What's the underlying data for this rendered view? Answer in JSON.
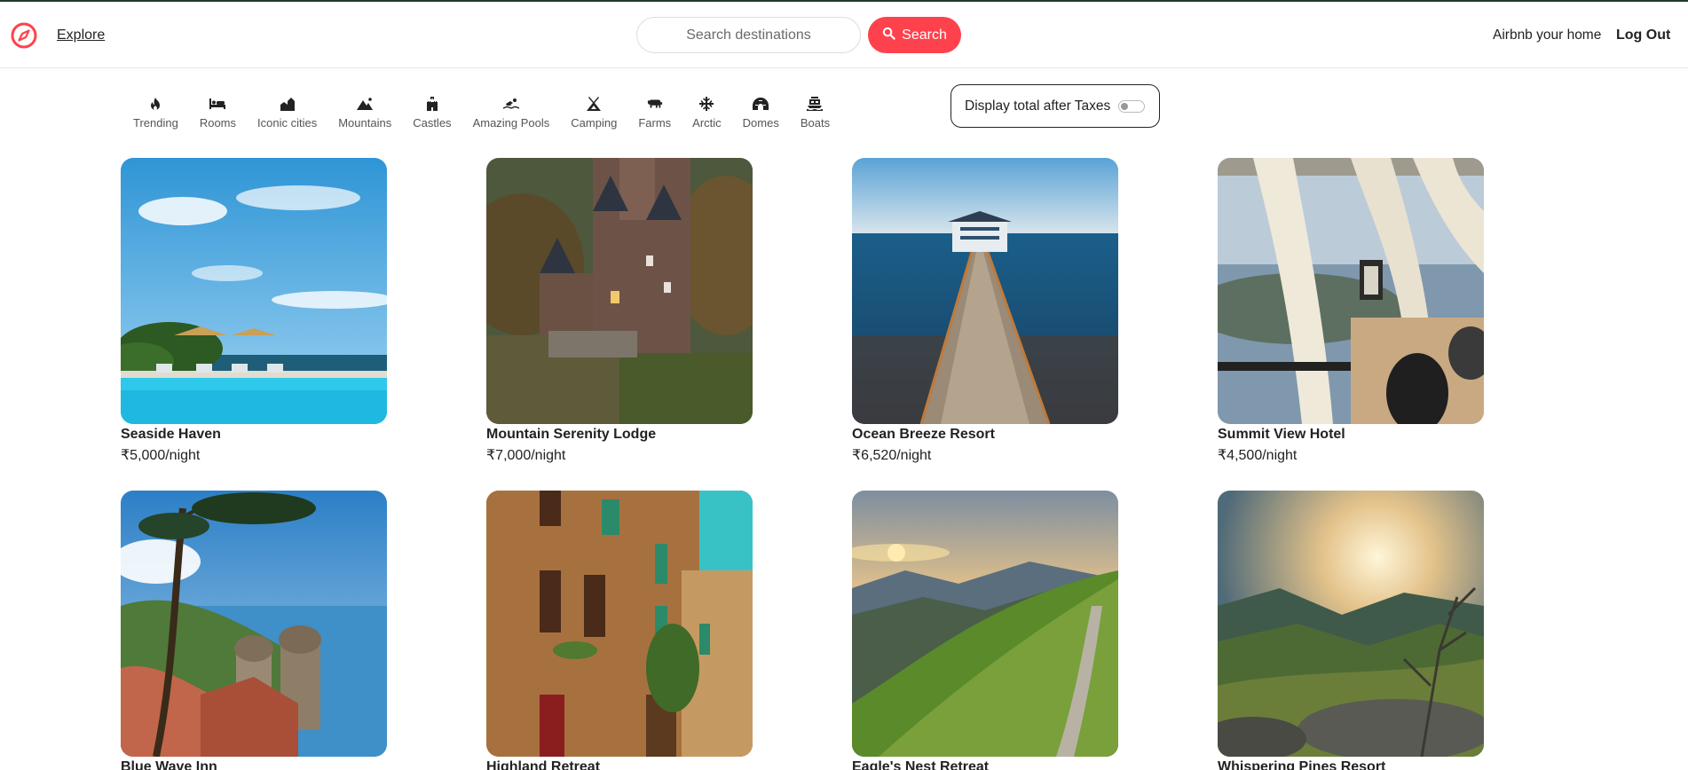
{
  "nav": {
    "logo_icon": "compass-icon",
    "explore_label": "Explore",
    "search_placeholder": "Search destinations",
    "search_button_label": "Search",
    "host_link": "Airbnb your home",
    "logout_link": "Log Out",
    "brand_color": "#fe424d"
  },
  "filters": [
    {
      "label": "Trending",
      "icon": "fire-icon"
    },
    {
      "label": "Rooms",
      "icon": "bed-icon"
    },
    {
      "label": "Iconic cities",
      "icon": "city-icon"
    },
    {
      "label": "Mountains",
      "icon": "mountain-icon"
    },
    {
      "label": "Castles",
      "icon": "castle-icon"
    },
    {
      "label": "Amazing Pools",
      "icon": "swimmer-icon"
    },
    {
      "label": "Camping",
      "icon": "tent-icon"
    },
    {
      "label": "Farms",
      "icon": "cow-icon"
    },
    {
      "label": "Arctic",
      "icon": "snowflake-icon"
    },
    {
      "label": "Domes",
      "icon": "igloo-icon"
    },
    {
      "label": "Boats",
      "icon": "ferry-icon"
    }
  ],
  "tax_toggle": {
    "label": "Display total after Taxes",
    "enabled": false
  },
  "listings": [
    {
      "title": "Seaside Haven",
      "price": "₹5,000/night"
    },
    {
      "title": "Mountain Serenity Lodge",
      "price": "₹7,000/night"
    },
    {
      "title": "Ocean Breeze Resort",
      "price": "₹6,520/night"
    },
    {
      "title": "Summit View Hotel",
      "price": "₹4,500/night"
    },
    {
      "title": "Blue Wave Inn",
      "price": ""
    },
    {
      "title": "Highland Retreat",
      "price": ""
    },
    {
      "title": "Eagle's Nest Retreat",
      "price": ""
    },
    {
      "title": "Whispering Pines Resort",
      "price": ""
    }
  ]
}
